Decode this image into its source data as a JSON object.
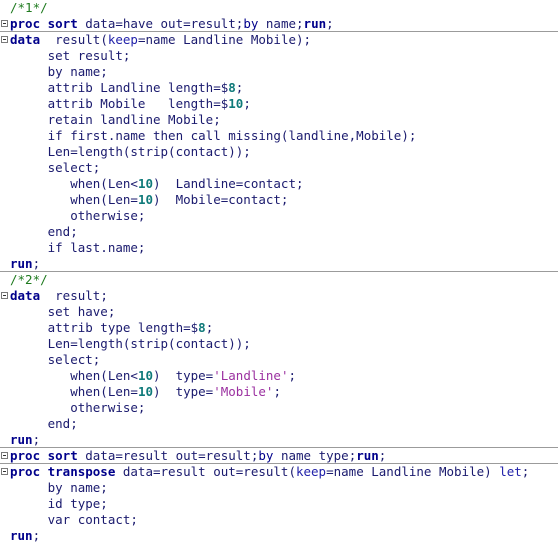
{
  "editor": {
    "title": "SAS Enhanced Editor",
    "background": "#ffffff",
    "colors": {
      "comment": "#1f7a1f",
      "keyword": "#00008b",
      "statement": "#00008b",
      "option": "#2222aa",
      "plain": "#1a1a6e",
      "number": "#0f7a7a",
      "string": "#9b30a0",
      "separator": "#9b9b9b",
      "fold_border": "#7a7a7a"
    },
    "fold_marker_icon": "collapse-minus-box-icon",
    "lines": [
      {
        "n": 1,
        "fold": false,
        "separator": false,
        "tokens": [
          {
            "t": "comment",
            "s": "/*1*/"
          }
        ]
      },
      {
        "n": 2,
        "fold": true,
        "separator": true,
        "tokens": [
          {
            "t": "keyword",
            "s": "proc sort"
          },
          {
            "t": "plain",
            "s": " data=have out=result"
          },
          {
            "t": "punct",
            "s": ";"
          },
          {
            "t": "stmt",
            "s": "by"
          },
          {
            "t": "plain",
            "s": " name"
          },
          {
            "t": "punct",
            "s": ";"
          },
          {
            "t": "keyword",
            "s": "run"
          },
          {
            "t": "punct",
            "s": ";"
          }
        ]
      },
      {
        "n": 3,
        "fold": true,
        "separator": false,
        "tokens": [
          {
            "t": "keyword",
            "s": "data"
          },
          {
            "t": "plain",
            "s": "  result("
          },
          {
            "t": "option",
            "s": "keep"
          },
          {
            "t": "plain",
            "s": "=name Landline Mobile);"
          }
        ]
      },
      {
        "n": 4,
        "fold": false,
        "separator": false,
        "tokens": [
          {
            "t": "plain",
            "s": "     set result;"
          }
        ]
      },
      {
        "n": 5,
        "fold": false,
        "separator": false,
        "tokens": [
          {
            "t": "plain",
            "s": "     by name;"
          }
        ]
      },
      {
        "n": 6,
        "fold": false,
        "separator": false,
        "tokens": [
          {
            "t": "plain",
            "s": "     attrib Landline length=$"
          },
          {
            "t": "number",
            "s": "8"
          },
          {
            "t": "plain",
            "s": ";"
          }
        ]
      },
      {
        "n": 7,
        "fold": false,
        "separator": false,
        "tokens": [
          {
            "t": "plain",
            "s": "     attrib Mobile   length=$"
          },
          {
            "t": "number",
            "s": "10"
          },
          {
            "t": "plain",
            "s": ";"
          }
        ]
      },
      {
        "n": 8,
        "fold": false,
        "separator": false,
        "tokens": [
          {
            "t": "plain",
            "s": "     retain landline Mobile;"
          }
        ]
      },
      {
        "n": 9,
        "fold": false,
        "separator": false,
        "tokens": [
          {
            "t": "plain",
            "s": "     if first.name then call missing(landline,Mobile);"
          }
        ]
      },
      {
        "n": 10,
        "fold": false,
        "separator": false,
        "tokens": [
          {
            "t": "plain",
            "s": "     Len=length(strip(contact));"
          }
        ]
      },
      {
        "n": 11,
        "fold": false,
        "separator": false,
        "tokens": [
          {
            "t": "plain",
            "s": "     select;"
          }
        ]
      },
      {
        "n": 12,
        "fold": false,
        "separator": false,
        "tokens": [
          {
            "t": "plain",
            "s": "        when(Len<"
          },
          {
            "t": "number",
            "s": "10"
          },
          {
            "t": "plain",
            "s": ")  Landline=contact;"
          }
        ]
      },
      {
        "n": 13,
        "fold": false,
        "separator": false,
        "tokens": [
          {
            "t": "plain",
            "s": "        when(Len="
          },
          {
            "t": "number",
            "s": "10"
          },
          {
            "t": "plain",
            "s": ")  Mobile=contact;"
          }
        ]
      },
      {
        "n": 14,
        "fold": false,
        "separator": false,
        "tokens": [
          {
            "t": "plain",
            "s": "        otherwise;"
          }
        ]
      },
      {
        "n": 15,
        "fold": false,
        "separator": false,
        "tokens": [
          {
            "t": "plain",
            "s": "     end;"
          }
        ]
      },
      {
        "n": 16,
        "fold": false,
        "separator": false,
        "tokens": [
          {
            "t": "plain",
            "s": "     if last.name;"
          }
        ]
      },
      {
        "n": 17,
        "fold": false,
        "separator": true,
        "tokens": [
          {
            "t": "keyword",
            "s": "run"
          },
          {
            "t": "punct",
            "s": ";"
          }
        ]
      },
      {
        "n": 18,
        "fold": false,
        "separator": false,
        "tokens": [
          {
            "t": "comment",
            "s": "/*2*/"
          }
        ]
      },
      {
        "n": 19,
        "fold": true,
        "separator": false,
        "tokens": [
          {
            "t": "keyword",
            "s": "data"
          },
          {
            "t": "plain",
            "s": "  result;"
          }
        ]
      },
      {
        "n": 20,
        "fold": false,
        "separator": false,
        "tokens": [
          {
            "t": "plain",
            "s": "     set have;"
          }
        ]
      },
      {
        "n": 21,
        "fold": false,
        "separator": false,
        "tokens": [
          {
            "t": "plain",
            "s": "     attrib type length=$"
          },
          {
            "t": "number",
            "s": "8"
          },
          {
            "t": "plain",
            "s": ";"
          }
        ]
      },
      {
        "n": 22,
        "fold": false,
        "separator": false,
        "tokens": [
          {
            "t": "plain",
            "s": "     Len=length(strip(contact));"
          }
        ]
      },
      {
        "n": 23,
        "fold": false,
        "separator": false,
        "tokens": [
          {
            "t": "plain",
            "s": "     select;"
          }
        ]
      },
      {
        "n": 24,
        "fold": false,
        "separator": false,
        "tokens": [
          {
            "t": "plain",
            "s": "        when(Len<"
          },
          {
            "t": "number",
            "s": "10"
          },
          {
            "t": "plain",
            "s": ")  type="
          },
          {
            "t": "string",
            "s": "'Landline'"
          },
          {
            "t": "plain",
            "s": ";"
          }
        ]
      },
      {
        "n": 25,
        "fold": false,
        "separator": false,
        "tokens": [
          {
            "t": "plain",
            "s": "        when(Len="
          },
          {
            "t": "number",
            "s": "10"
          },
          {
            "t": "plain",
            "s": ")  type="
          },
          {
            "t": "string",
            "s": "'Mobile'"
          },
          {
            "t": "plain",
            "s": ";"
          }
        ]
      },
      {
        "n": 26,
        "fold": false,
        "separator": false,
        "tokens": [
          {
            "t": "plain",
            "s": "        otherwise;"
          }
        ]
      },
      {
        "n": 27,
        "fold": false,
        "separator": false,
        "tokens": [
          {
            "t": "plain",
            "s": "     end;"
          }
        ]
      },
      {
        "n": 28,
        "fold": false,
        "separator": true,
        "tokens": [
          {
            "t": "keyword",
            "s": "run"
          },
          {
            "t": "punct",
            "s": ";"
          }
        ]
      },
      {
        "n": 29,
        "fold": true,
        "separator": true,
        "tokens": [
          {
            "t": "keyword",
            "s": "proc sort"
          },
          {
            "t": "plain",
            "s": " data=result out=result"
          },
          {
            "t": "punct",
            "s": ";"
          },
          {
            "t": "stmt",
            "s": "by"
          },
          {
            "t": "plain",
            "s": " name type"
          },
          {
            "t": "punct",
            "s": ";"
          },
          {
            "t": "keyword",
            "s": "run"
          },
          {
            "t": "punct",
            "s": ";"
          }
        ]
      },
      {
        "n": 30,
        "fold": true,
        "separator": false,
        "tokens": [
          {
            "t": "keyword",
            "s": "proc transpose"
          },
          {
            "t": "plain",
            "s": " data=result out=result("
          },
          {
            "t": "option",
            "s": "keep"
          },
          {
            "t": "plain",
            "s": "=name Landline Mobile) "
          },
          {
            "t": "option",
            "s": "let"
          },
          {
            "t": "plain",
            "s": ";"
          }
        ]
      },
      {
        "n": 31,
        "fold": false,
        "separator": false,
        "tokens": [
          {
            "t": "plain",
            "s": "     by name;"
          }
        ]
      },
      {
        "n": 32,
        "fold": false,
        "separator": false,
        "tokens": [
          {
            "t": "plain",
            "s": "     id type;"
          }
        ]
      },
      {
        "n": 33,
        "fold": false,
        "separator": false,
        "tokens": [
          {
            "t": "plain",
            "s": "     var contact;"
          }
        ]
      },
      {
        "n": 34,
        "fold": false,
        "separator": false,
        "tokens": [
          {
            "t": "keyword",
            "s": "run"
          },
          {
            "t": "punct",
            "s": ";"
          }
        ]
      }
    ]
  }
}
